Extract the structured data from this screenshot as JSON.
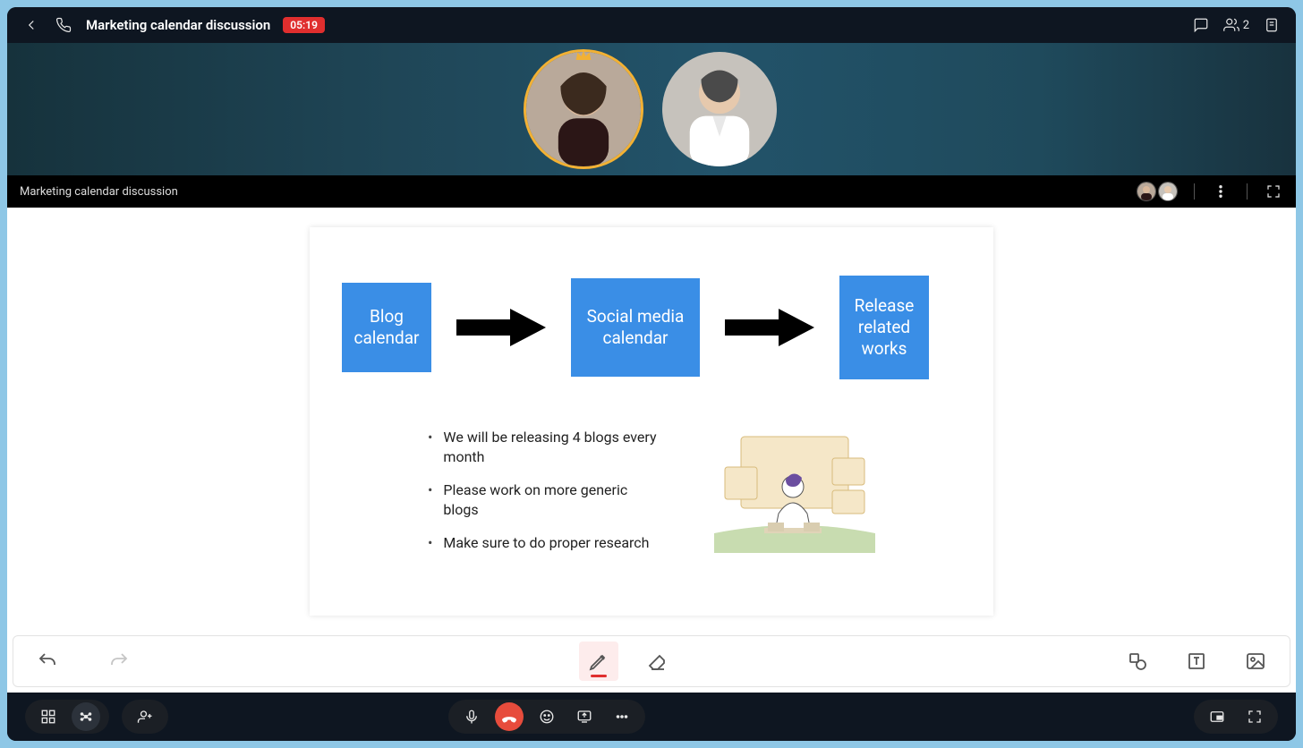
{
  "header": {
    "title": "Marketing calendar discussion",
    "timer": "05:19",
    "participant_count": "2"
  },
  "share_header": {
    "title": "Marketing calendar discussion"
  },
  "slide": {
    "box1": "Blog calendar",
    "box2": "Social media calendar",
    "box3": "Release related works",
    "bullets": [
      "We will be releasing 4 blogs every month",
      "Please work on more generic blogs",
      "Make sure to do proper research"
    ]
  }
}
